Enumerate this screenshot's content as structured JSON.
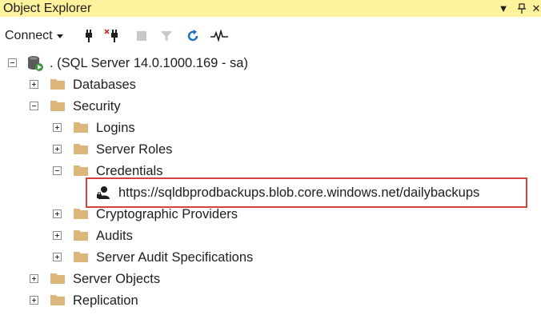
{
  "panel": {
    "title": "Object Explorer",
    "pin_glyph": "▾",
    "pin2_glyph": "ᛘ",
    "close_glyph": "×"
  },
  "toolbar": {
    "connect_label": "Connect",
    "icons": [
      "connect-plug-icon",
      "disconnect-icon",
      "stop-icon",
      "filter-icon",
      "refresh-icon",
      "activity-monitor-icon"
    ]
  },
  "tree": {
    "server": ". (SQL Server 14.0.1000.169 - sa)",
    "databases": "Databases",
    "security": "Security",
    "logins": "Logins",
    "server_roles": "Server Roles",
    "credentials": "Credentials",
    "credential_item": "https://sqldbprodbackups.blob.core.windows.net/dailybackups",
    "crypto_providers": "Cryptographic Providers",
    "audits": "Audits",
    "audit_specs": "Server Audit Specifications",
    "server_objects": "Server Objects",
    "replication": "Replication"
  },
  "colors": {
    "title_bg": "#fff29d",
    "folder": "#dcb67a",
    "highlight": "#d9413c",
    "refresh": "#1e6fc2"
  }
}
